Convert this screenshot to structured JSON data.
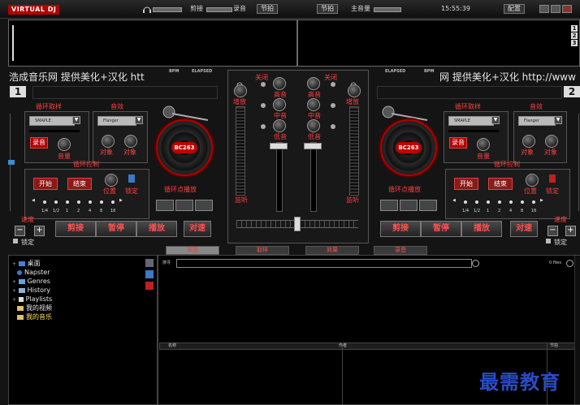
{
  "topbar": {
    "logo": "VIRTUAL DJ",
    "record_label": "剪接",
    "record_label2": "录音",
    "sync_btn": "节拍",
    "sync_btn2": "节拍",
    "master_label": "主音量",
    "clock": "15:55:39",
    "config_btn": "配置"
  },
  "waveform": {
    "deck_indicators": [
      "1",
      "2",
      "3"
    ]
  },
  "title_strip": {
    "left_text": "浩成音乐网 提供美化+汉化 htt",
    "right_text": "网 提供美化+汉化 http://www",
    "bpm_label": "BPM",
    "elapsed_label": "ELAPSED",
    "deck_left_num": "1",
    "deck_right_num": "2"
  },
  "deck_left": {
    "loop_sample_title": "循环取样",
    "loop_select": "SMAPLE",
    "record_btn": "录音",
    "volume_label": "音量",
    "effects_title": "音效",
    "effects_select": "Flanger",
    "param1": "对象",
    "param2": "对象",
    "turntable_label": "BC263",
    "loop_control_title": "循环控制",
    "start_btn": "开始",
    "end_btn": "结束",
    "position_label": "位置",
    "lock_label": "锁定",
    "cue_title": "循环点播放",
    "beat_labels": [
      "1/4",
      "1/2",
      "1",
      "2",
      "4",
      "8",
      "16"
    ],
    "speed_label": "速度",
    "speed_minus": "−",
    "speed_plus": "+",
    "speed_lock": "锁定",
    "cue_btn": "剪接",
    "pause_btn": "暂停",
    "play_btn": "播放",
    "sync_btn": "对速"
  },
  "deck_right": {
    "loop_sample_title": "循环取样",
    "loop_select": "SMAPLE",
    "record_btn": "录音",
    "volume_label": "音量",
    "effects_title": "音效",
    "effects_select": "Flanger",
    "param1": "对象",
    "param2": "对象",
    "turntable_label": "BC263",
    "loop_control_title": "循环控制",
    "start_btn": "开始",
    "end_btn": "结束",
    "position_label": "位置",
    "lock_label": "锁定",
    "cue_title": "循环点播放",
    "beat_labels": [
      "1/4",
      "1/2",
      "1",
      "2",
      "4",
      "8",
      "16"
    ],
    "speed_label": "速度",
    "speed_minus": "−",
    "speed_plus": "+",
    "speed_lock": "锁定",
    "cue_btn": "剪接",
    "pause_btn": "暂停",
    "play_btn": "播放",
    "sync_btn": "对速"
  },
  "mixer": {
    "kill_left": "关闭",
    "kill_right": "关闭",
    "gain_left": "增放",
    "gain_right": "增放",
    "high_left": "高音",
    "high_right": "高音",
    "mid_left": "中音",
    "mid_right": "中音",
    "low_left": "低音",
    "low_right": "低音",
    "listen_left": "监听",
    "listen_right": "监听"
  },
  "tabs": [
    "浏览",
    "取样",
    "效果",
    "录音"
  ],
  "browser": {
    "tree": [
      {
        "label": "桌面",
        "prefix": "+"
      },
      {
        "label": "Napster",
        "prefix": ""
      },
      {
        "label": "Genres",
        "prefix": "+"
      },
      {
        "label": "History",
        "prefix": "+"
      },
      {
        "label": "Playlists",
        "prefix": "+"
      },
      {
        "label": "我的视频",
        "prefix": ""
      },
      {
        "label": "我的音乐",
        "prefix": ""
      }
    ],
    "search_label": "搜寻",
    "files_count": "0 files",
    "columns": [
      "名称",
      "作者",
      "节拍"
    ]
  },
  "watermark": "最需教育",
  "colors": {
    "accent": "#b00000",
    "label_red": "#ff4040",
    "watermark": "#2a4cc4"
  }
}
